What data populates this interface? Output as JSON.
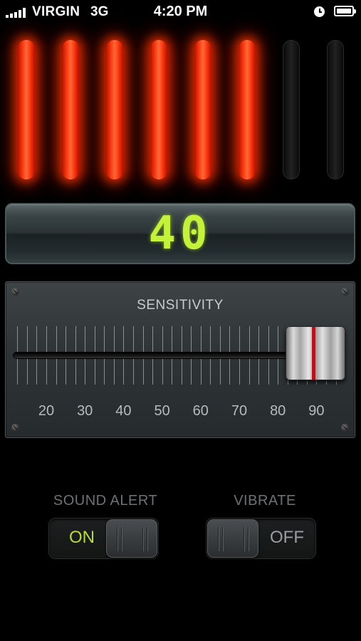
{
  "status_bar": {
    "carrier": "VIRGIN",
    "network": "3G",
    "time": "4:20 PM"
  },
  "level_meter": {
    "total_bars": 8,
    "lit_bars": 6,
    "lit_color": "#ff3d12",
    "unlit_color": "#1a1a1a"
  },
  "readout": {
    "value": "40",
    "color": "#c4f23a"
  },
  "sensitivity": {
    "title": "SENSITIVITY",
    "scale_labels": [
      "20",
      "30",
      "40",
      "50",
      "60",
      "70",
      "80",
      "90"
    ],
    "selected_value": 94
  },
  "sound_alert": {
    "label": "SOUND ALERT",
    "state": "ON",
    "state_color": "#b8dc3a"
  },
  "vibrate": {
    "label": "VIBRATE",
    "state": "OFF",
    "state_color": "#9a9ea0"
  }
}
